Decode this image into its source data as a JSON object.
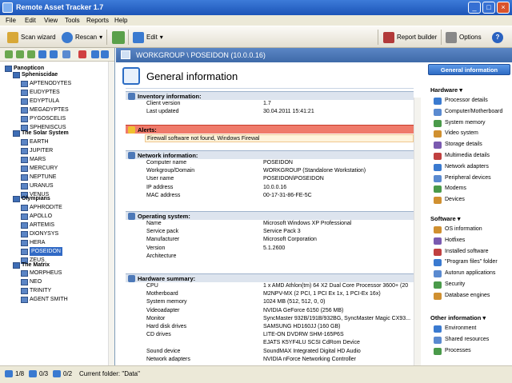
{
  "window": {
    "title": "Remote Asset Tracker 1.7"
  },
  "menu": [
    "File",
    "Edit",
    "View",
    "Tools",
    "Reports",
    "Help"
  ],
  "toolbar": {
    "scan": "Scan wizard",
    "rescan": "Rescan",
    "edit": "Edit",
    "report": "Report builder",
    "options": "Options"
  },
  "tree": [
    {
      "label": "Panopticon",
      "level": 0,
      "group": true
    },
    {
      "label": "Spheniscidae",
      "level": 1,
      "group": true
    },
    {
      "label": "APTENODYTES",
      "level": 2
    },
    {
      "label": "EUDYPTES",
      "level": 2
    },
    {
      "label": "EDYPTULA",
      "level": 2
    },
    {
      "label": "MEGADYPTES",
      "level": 2
    },
    {
      "label": "PYGOSCELIS",
      "level": 2
    },
    {
      "label": "SPHENISCUS",
      "level": 2
    },
    {
      "label": "The Solar System",
      "level": 1,
      "group": true
    },
    {
      "label": "EARTH",
      "level": 2
    },
    {
      "label": "JUPITER",
      "level": 2
    },
    {
      "label": "MARS",
      "level": 2
    },
    {
      "label": "MERCURY",
      "level": 2
    },
    {
      "label": "NEPTUNE",
      "level": 2
    },
    {
      "label": "URANUS",
      "level": 2
    },
    {
      "label": "VENUS",
      "level": 2
    },
    {
      "label": "Olympians",
      "level": 1,
      "group": true
    },
    {
      "label": "APHRODITE",
      "level": 2
    },
    {
      "label": "APOLLO",
      "level": 2
    },
    {
      "label": "ARTEMIS",
      "level": 2
    },
    {
      "label": "DIONYSYS",
      "level": 2
    },
    {
      "label": "HERA",
      "level": 2
    },
    {
      "label": "POSEIDON",
      "level": 2,
      "selected": true
    },
    {
      "label": "ZEUS",
      "level": 2
    },
    {
      "label": "The Matrix",
      "level": 1,
      "group": true
    },
    {
      "label": "MORPHEUS",
      "level": 2
    },
    {
      "label": "NEO",
      "level": 2
    },
    {
      "label": "TRINITY",
      "level": 2
    },
    {
      "label": "AGENT SMITH",
      "level": 2
    }
  ],
  "path": "WORKGROUP \\ POSEIDON (10.0.0.16)",
  "page_title": "General information",
  "sections": [
    {
      "title": "Inventory information:",
      "rows": [
        [
          "Client version",
          "1.7"
        ],
        [
          "Last updated",
          "30.04.2011 15:41:21"
        ]
      ]
    },
    {
      "title": "Alerts:",
      "alert": true,
      "text": "Firewall software not found, Windows Firewal"
    },
    {
      "title": "Network information:",
      "rows": [
        [
          "Computer name",
          "POSEIDON"
        ],
        [
          "Workgroup/Domain",
          "WORKGROUP  (Standalone Workstation)"
        ],
        [
          "User name",
          "POSEIDON\\POSEIDON"
        ],
        [
          "IP address",
          "10.0.0.16"
        ],
        [
          "MAC address",
          "00-17-31-86-FE-5C"
        ]
      ]
    },
    {
      "title": "Operating system:",
      "rows": [
        [
          "Name",
          "Microsoft Windows XP Professional"
        ],
        [
          "Service pack",
          "Service Pack 3"
        ],
        [
          "Manufacturer",
          "Microsoft Corporation"
        ],
        [
          "Version",
          "5.1.2600"
        ],
        [
          "Architecture",
          ""
        ]
      ]
    },
    {
      "title": "Hardware summary:",
      "rows": [
        [
          "CPU",
          "1 x AMD Athlon(tm) 64 X2 Dual Core Processor 3600+ (20"
        ],
        [
          "Motherboard",
          "M2NPV-MX (2 PCI, 1 PCI Ex 1x, 1 PCI-Ex 16x)"
        ],
        [
          "System memory",
          "1024 MB (512, 512, 0, 0)"
        ],
        [
          "Videoadapter",
          "NVIDIA GeForce 6150 (256 MB)"
        ],
        [
          "Monitor",
          "SyncMaster 932B/191B/932BG, SyncMaster Magic CX93..."
        ],
        [
          "Hard disk drives",
          "SAMSUNG HD160JJ (160 GB)"
        ],
        [
          "CD drives",
          "LITE-ON DVDRW SHM-165P6S"
        ],
        [
          "",
          "EJATS K5YF4LU SCSI CdRom Device"
        ],
        [
          "Sound device",
          "SoundMAX Integrated Digital HD Audio"
        ],
        [
          "Network adapters",
          "NVIDIA nForce Networking Controller"
        ]
      ]
    }
  ],
  "right_panel": {
    "active": "General information",
    "groups": [
      {
        "title": "Hardware",
        "items": [
          "Processor details",
          "Computer/Motherboard",
          "System memory",
          "Video system",
          "Storage details",
          "Multimedia details",
          "Network adapters",
          "Peripheral devices",
          "Modems",
          "Devices"
        ]
      },
      {
        "title": "Software",
        "items": [
          "OS information",
          "Hotfixes",
          "Installed software",
          "\"Program files\" folder",
          "Autorun applications",
          "Security",
          "Database engines"
        ]
      },
      {
        "title": "Other information",
        "items": [
          "Environment",
          "Shared resources",
          "Processes"
        ]
      }
    ]
  },
  "status": {
    "count1": "1/8",
    "count2": "0/3",
    "count3": "0/2",
    "folder": "Current folder: \"Data\""
  }
}
